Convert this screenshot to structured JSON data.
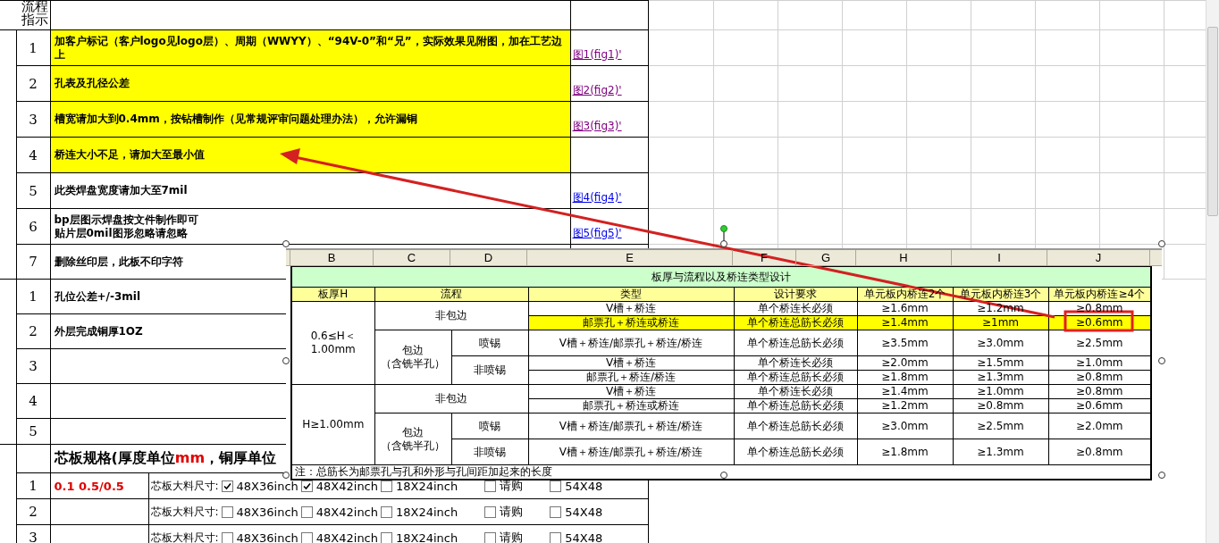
{
  "sheet": {
    "corner_label": [
      "流程",
      "指示"
    ],
    "process_rows": [
      {
        "number": "1",
        "lines": [
          "加客户标记（客户logo见logo层）、周期（WWYY）、“94V-0”和“兄”，实际效果见附图，加在工艺边上"
        ],
        "highlighted": true,
        "link": {
          "text": "图1(fig1)'",
          "visited": true
        }
      },
      {
        "number": "2",
        "lines": [
          "孔表及孔径公差"
        ],
        "highlighted": true,
        "link": {
          "text": "图2(fig2)'",
          "visited": true
        }
      },
      {
        "number": "3",
        "lines": [
          "槽宽请加大到0.4mm，按钻槽制作（见常规评审问题处理办法），允许漏铜"
        ],
        "highlighted": true,
        "link": {
          "text": "图3(fig3)'",
          "visited": true
        }
      },
      {
        "number": "4",
        "lines": [
          "桥连大小不足，请加大至最小值"
        ],
        "highlighted": true
      },
      {
        "number": "5",
        "lines": [
          "此类焊盘宽度请加大至7mil"
        ],
        "highlighted": false,
        "link": {
          "text": "图4(fig4)'",
          "visited": false
        }
      },
      {
        "number": "6",
        "lines": [
          "bp层图示焊盘按文件制作即可",
          "贴片层0mil图形忽略请忽略"
        ],
        "highlighted": false,
        "link": {
          "text": "图5(fig5)'",
          "visited": false
        }
      },
      {
        "number": "7",
        "lines": [
          "删除丝印层，此板不印字符"
        ],
        "highlighted": false
      }
    ],
    "check_rows": [
      {
        "number": "1",
        "text": "孔位公差+/-3mil"
      },
      {
        "number": "2",
        "text": "外层完成铜厚1OZ"
      },
      {
        "number": "3"
      },
      {
        "number": "4"
      },
      {
        "number": "5"
      }
    ],
    "core_spec": {
      "title_parts": [
        {
          "text": "芯板规格(厚度单位",
          "kind": "plain"
        },
        {
          "text": "mm",
          "kind": "unit"
        },
        {
          "text": "，铜厚单位",
          "kind": "plain"
        }
      ],
      "rows": [
        {
          "number": "1",
          "value": "0.1 0.5/0.5",
          "label": "芯板大料尺寸:",
          "options": [
            {
              "label": "48X36inch",
              "checked": true
            },
            {
              "label": "48X42inch",
              "checked": true
            },
            {
              "label": "18X24inch",
              "checked": false
            },
            {
              "label": "请购",
              "checked": false
            },
            {
              "label": "54X48",
              "checked": false
            }
          ]
        },
        {
          "number": "2",
          "label": "芯板大料尺寸:",
          "options": [
            {
              "label": "48X36inch",
              "checked": false
            },
            {
              "label": "48X42inch",
              "checked": false
            },
            {
              "label": "18X24inch",
              "checked": false
            },
            {
              "label": "请购",
              "checked": false
            },
            {
              "label": "54X48",
              "checked": false
            }
          ]
        },
        {
          "number": "3",
          "label": "芯板大料尺寸:",
          "options": [
            {
              "label": "48X36inch",
              "checked": false
            },
            {
              "label": "48X42inch",
              "checked": false
            },
            {
              "label": "18X24inch",
              "checked": false
            },
            {
              "label": "请购",
              "checked": false
            },
            {
              "label": "54X48",
              "checked": false
            }
          ]
        }
      ]
    }
  },
  "bridge_table": {
    "column_headers": [
      "B",
      "C",
      "D",
      "E",
      "F",
      "G",
      "H",
      "I",
      "J"
    ],
    "title": "板厚与流程以及桥连类型设计",
    "headers": [
      "板厚H",
      "流程",
      "类型",
      "设计要求",
      "单元板内桥连2个",
      "单元板内桥连3个",
      "单元板内桥连≥4个"
    ],
    "groups": [
      {
        "thickness_lines": [
          "0.6≤H＜",
          "1.00mm"
        ],
        "processes": [
          {
            "name_lines": [
              "非包边"
            ],
            "types": [
              {
                "type": "V槽＋桥连",
                "requirement": "单个桥连长必须",
                "values": [
                  "≥1.6mm",
                  "≥1.2mm",
                  "≥0.8mm"
                ],
                "highlighted": false
              },
              {
                "type": "邮票孔＋桥连或桥连",
                "requirement": "单个桥连总筋长必须",
                "values": [
                  "≥1.4mm",
                  "≥1mm",
                  "≥0.6mm"
                ],
                "highlighted": true
              }
            ]
          },
          {
            "name_lines": [
              "包边",
              "（含铣半孔）"
            ],
            "subs": [
              {
                "name": "喷锡",
                "types": [
                  {
                    "type": "V槽＋桥连/邮票孔＋桥连/桥连",
                    "requirement": "单个桥连总筋长必须",
                    "values": [
                      "≥3.5mm",
                      "≥3.0mm",
                      "≥2.5mm"
                    ],
                    "highlighted": false
                  }
                ]
              },
              {
                "name": "非喷锡",
                "types": [
                  {
                    "type": "V槽＋桥连",
                    "requirement": "单个桥连长必须",
                    "values": [
                      "≥2.0mm",
                      "≥1.5mm",
                      "≥1.0mm"
                    ],
                    "highlighted": false
                  },
                  {
                    "type": "邮票孔＋桥连/桥连",
                    "requirement": "单个桥连总筋长必须",
                    "values": [
                      "≥1.8mm",
                      "≥1.3mm",
                      "≥0.8mm"
                    ],
                    "highlighted": false
                  }
                ]
              }
            ]
          }
        ]
      },
      {
        "thickness_lines": [
          "H≥1.00mm"
        ],
        "processes": [
          {
            "name_lines": [
              "非包边"
            ],
            "types": [
              {
                "type": "V槽＋桥连",
                "requirement": "单个桥连长必须",
                "values": [
                  "≥1.4mm",
                  "≥1.0mm",
                  "≥0.8mm"
                ],
                "highlighted": false
              },
              {
                "type": "邮票孔＋桥连或桥连",
                "requirement": "单个桥连总筋长必须",
                "values": [
                  "≥1.2mm",
                  "≥0.8mm",
                  "≥0.6mm"
                ],
                "highlighted": false
              }
            ]
          },
          {
            "name_lines": [
              "包边",
              "（含铣半孔）"
            ],
            "subs": [
              {
                "name": "喷锡",
                "types": [
                  {
                    "type": "V槽＋桥连/邮票孔＋桥连/桥连",
                    "requirement": "单个桥连总筋长必须",
                    "values": [
                      "≥3.0mm",
                      "≥2.5mm",
                      "≥2.0mm"
                    ],
                    "highlighted": false
                  }
                ]
              },
              {
                "name": "非喷锡",
                "types": [
                  {
                    "type": "V槽＋桥连/邮票孔＋桥连/桥连",
                    "requirement": "单个桥连总筋长必须",
                    "values": [
                      "≥1.8mm",
                      "≥1.3mm",
                      "≥0.8mm"
                    ],
                    "highlighted": false
                  }
                ]
              }
            ]
          }
        ]
      }
    ],
    "note": "注：总筋长为邮票孔与孔和外形与孔间距加起来的长度"
  }
}
